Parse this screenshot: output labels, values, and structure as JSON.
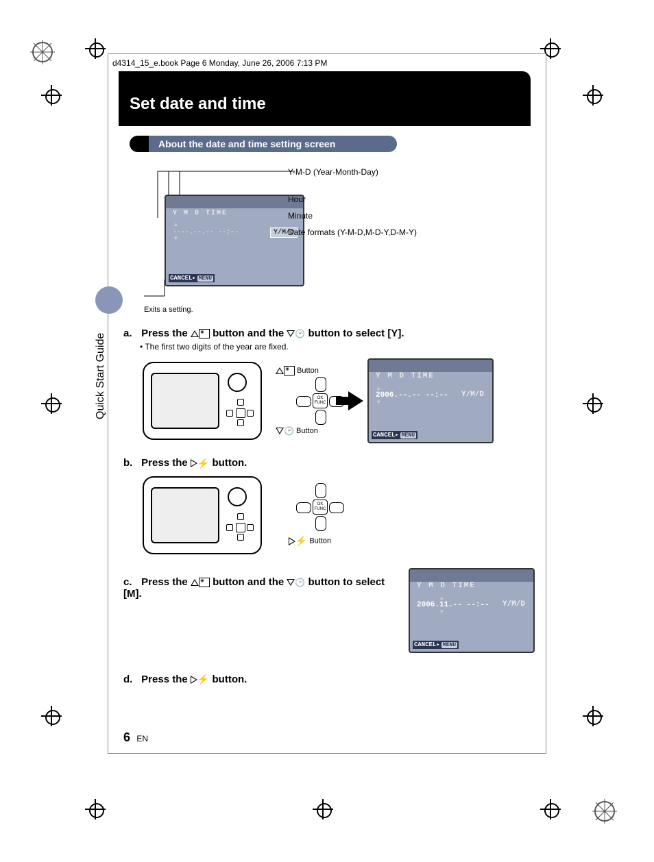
{
  "header": "d4314_15_e.book  Page 6  Monday, June 26, 2006  7:13 PM",
  "title": "Set date and time",
  "subtitle": "About the date and time setting screen",
  "sidebar": "Quick Start Guide",
  "diagram_labels": {
    "ymd": "Y-M-D (Year-Month-Day)",
    "hour": "Hour",
    "minute": "Minute",
    "formats": "Date formats (Y-M-D,M-D-Y,D-M-Y)"
  },
  "lcd_main": {
    "toprow": "Y  M  D  TIME",
    "midrow": "----.--.-- --:--",
    "format": "Y/M/D",
    "cancel": "CANCEL",
    "menu": "MENU"
  },
  "exits_label": "Exits a setting.",
  "steps": {
    "a": {
      "prefix": "a.",
      "pre": "Press the ",
      "mid": " button and the ",
      "post": " button to select [Y].",
      "note": "• The first two digits of the year are fixed."
    },
    "b": {
      "prefix": "b.",
      "pre": "Press the ",
      "post": " button."
    },
    "c": {
      "prefix": "c.",
      "pre": "Press the ",
      "mid": " button and the ",
      "post": " button to select [M]."
    },
    "d": {
      "prefix": "d.",
      "pre": "Press the ",
      "post": " button."
    }
  },
  "dpad_labels": {
    "up": " Button",
    "down": " Button",
    "right": " Button",
    "center": "OK\nFUNC"
  },
  "lcd_a": {
    "toprow": "Y  M  D TIME",
    "midrow": "2006.--.-- --:--",
    "format": "Y/M/D",
    "cancel": "CANCEL",
    "menu": "MENU"
  },
  "lcd_c": {
    "toprow": "Y  M  D TIME",
    "midrow": "2006.11.-- --:--",
    "format": "Y/M/D",
    "cancel": "CANCEL",
    "menu": "MENU"
  },
  "footer": {
    "page": "6",
    "lang": "EN"
  }
}
